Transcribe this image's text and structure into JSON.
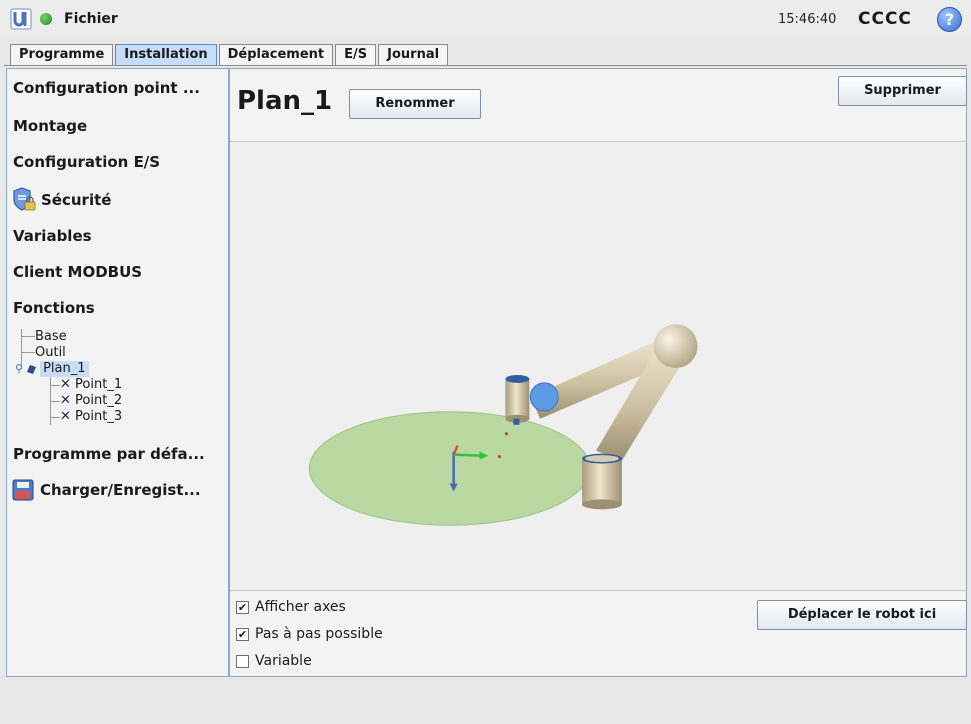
{
  "header": {
    "file_label": "Fichier",
    "time": "15:46:40",
    "user": "CCCC",
    "help_glyph": "?"
  },
  "tabs": [
    {
      "label": "Programme",
      "active": false
    },
    {
      "label": "Installation",
      "active": true
    },
    {
      "label": "Déplacement",
      "active": false
    },
    {
      "label": "E/S",
      "active": false
    },
    {
      "label": "Journal",
      "active": false
    }
  ],
  "sidebar": {
    "items": [
      "Configuration point ...",
      "Montage",
      "Configuration E/S",
      "Sécurité",
      "Variables",
      "Client MODBUS",
      "Fonctions",
      "Programme par défa...",
      "Charger/Enregist..."
    ],
    "tree": {
      "base": "Base",
      "outil": "Outil",
      "plan": "Plan_1",
      "points": [
        "Point_1",
        "Point_2",
        "Point_3"
      ]
    }
  },
  "main": {
    "title": "Plan_1",
    "rename_button": "Renommer",
    "delete_button": "Supprimer",
    "move_robot_button": "Déplacer le robot ici",
    "checkboxes": [
      {
        "label": "Afficher axes",
        "checked": true
      },
      {
        "label": "Pas à pas possible",
        "checked": true
      },
      {
        "label": "Variable",
        "checked": false
      }
    ]
  },
  "colors": {
    "active_tab": "#c7dcf6",
    "plane": "#b9d8a2",
    "robot_link": "#d9ccae",
    "robot_joint_cap": "#5c9be4"
  }
}
